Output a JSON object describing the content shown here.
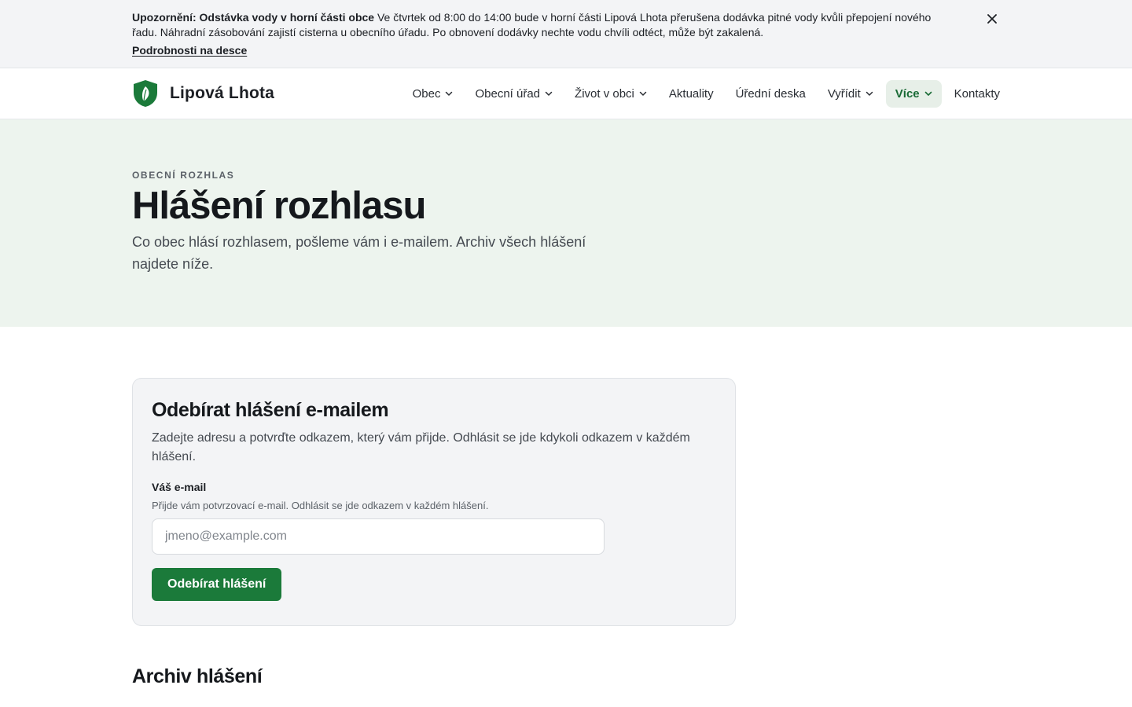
{
  "alert": {
    "title": "Upozornění: Odstávka vody v horní části obce",
    "text": "Ve čtvrtek od 8:00 do 14:00 bude v horní části Lipová Lhota přerušena dodávka pitné vody kvůli přepojení nového řadu. Náhradní zásobování zajistí cisterna u obecního úřadu. Po obnovení dodávky nechte vodu chvíli odtéct, může být zakalená.",
    "link": "Podrobnosti na desce",
    "close_icon": "close-icon"
  },
  "header": {
    "site_name": "Lipová Lhota",
    "logo_icon": "shield-leaf-icon",
    "nav": [
      {
        "label": "Obec",
        "dropdown": true
      },
      {
        "label": "Obecní úřad",
        "dropdown": true
      },
      {
        "label": "Život v obci",
        "dropdown": true
      },
      {
        "label": "Aktuality",
        "dropdown": false
      },
      {
        "label": "Úřední deska",
        "dropdown": false
      },
      {
        "label": "Vyřídit",
        "dropdown": true
      },
      {
        "label": "Více",
        "dropdown": true,
        "active": true
      },
      {
        "label": "Kontakty",
        "dropdown": false
      }
    ]
  },
  "hero": {
    "eyebrow": "OBECNÍ ROZHLAS",
    "title": "Hlášení rozhlasu",
    "lead": "Co obec hlásí rozhlasem, pošleme vám i e-mailem. Archiv všech hlášení najdete níže."
  },
  "subscribe": {
    "title": "Odebírat hlášení e-mailem",
    "description": "Zadejte adresu a potvrďte odkazem, který vám přijde. Odhlásit se jde kdykoli odkazem v každém hlášení.",
    "email_label": "Váš e-mail",
    "email_hint": "Přijde vám potvrzovací e-mail. Odhlásit se jde odkazem v každém hlášení.",
    "email_placeholder": "jmeno@example.com",
    "email_value": "",
    "submit_label": "Odebírat hlášení"
  },
  "archive": {
    "title": "Archiv hlášení"
  },
  "colors": {
    "brand_green": "#1b7a3a",
    "hero_bg": "#edf4ee",
    "nav_active_bg": "#e7efe8"
  }
}
